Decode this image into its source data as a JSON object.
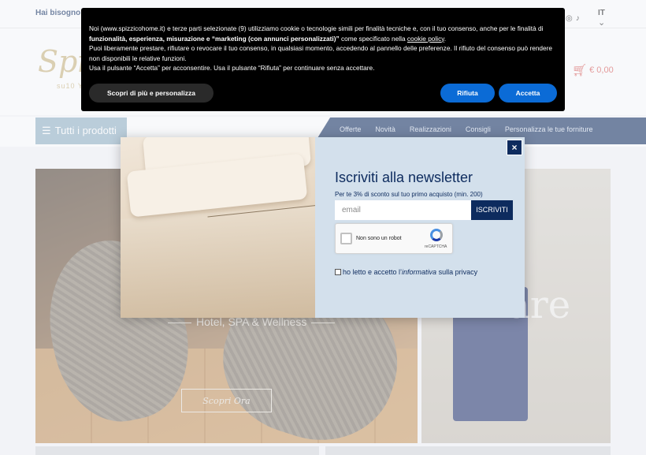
{
  "topbar": {
    "help_text": "Hai bisogno di",
    "social_icons": [
      "instagram-icon",
      "tiktok-icon"
    ],
    "language": "IT"
  },
  "header": {
    "logo_text": "Spizz",
    "logo_sub": "su10 Y",
    "cart_total": "€ 0,00"
  },
  "menu": {
    "all_products": "Tutti i prodotti",
    "nav": [
      "Offerte",
      "Novità",
      "Realizzazioni",
      "Consigli",
      "Personalizza le tue forniture"
    ]
  },
  "hero": {
    "left_caption": "Hotel, SPA & Wellness",
    "left_button": "Scopri Ora",
    "right_caption": "Mare"
  },
  "cookie_banner": {
    "line1_pre": "Noi (www.spizzicohome.it) e terze parti selezionate (9) utilizziamo cookie o tecnologie simili per finalità tecniche e, con il tuo consenso, anche per le finalità di ",
    "line1_bold": "funzionalità, esperienza, misurazione e “marketing (con annunci personalizzati)”",
    "line1_post": " come specificato nella ",
    "cookie_policy_link": "cookie policy",
    "line1_end": ".",
    "line2": "Puoi liberamente prestare, rifiutare o revocare il tuo consenso, in qualsiasi momento, accedendo al pannello delle preferenze. Il rifiuto del consenso può rendere non disponibili le relative funzioni.",
    "line3": "Usa il pulsante “Accetta” per acconsentire. Usa il pulsante “Rifiuta” per continuare senza accettare.",
    "more_button": "Scopri di più e personalizza",
    "reject_button": "Rifiuta",
    "accept_button": "Accetta"
  },
  "newsletter": {
    "close_label": "×",
    "title": "Iscriviti alla newsletter",
    "subtitle": "Per te 3% di sconto sul tuo primo acquisto (min. 200)",
    "email_placeholder": "email",
    "email_value": "",
    "submit_label": "ISCRIVITI",
    "captcha_label": "Non sono un robot",
    "captcha_brand": "reCAPTCHA",
    "privacy_pre": "ho letto e accetto l’",
    "privacy_em": "informativa",
    "privacy_post": " sulla privacy"
  },
  "colors": {
    "navy": "#0d2b5e",
    "cookie_button_blue": "#0b6bd6",
    "modal_bg": "#d3e0ec",
    "logo_gold": "#c9b27a",
    "cart_red": "#d9534f"
  }
}
